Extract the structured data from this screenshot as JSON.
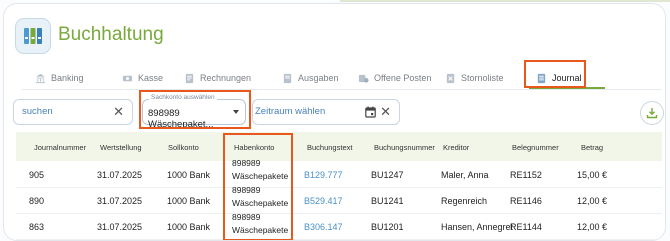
{
  "app": {
    "title": "Buchhaltung",
    "icon": "binders-icon"
  },
  "tabs": [
    {
      "label": "Banking",
      "icon": "bank-icon"
    },
    {
      "label": "Kasse",
      "icon": "cash-icon"
    },
    {
      "label": "Rechnungen",
      "icon": "invoice-icon"
    },
    {
      "label": "Ausgaben",
      "icon": "receipt-icon"
    },
    {
      "label": "Offene Posten",
      "icon": "open-items-icon"
    },
    {
      "label": "Stornoliste",
      "icon": "storno-icon"
    },
    {
      "label": "Journal",
      "icon": "journal-icon",
      "active": true
    }
  ],
  "filters": {
    "search_placeholder": "suchen",
    "account_label": "Sachkonto auswählen",
    "account_value": "898989 Wäschepaket...",
    "date_placeholder": "Zeitraum wählen"
  },
  "table": {
    "headers": [
      "Journalnummer",
      "Wertstellung",
      "Sollkonto",
      "Habenkonto",
      "Buchungstext",
      "Buchungsnummer",
      "Kreditor",
      "Belegnummer",
      "Betrag"
    ],
    "rows": [
      {
        "journalnummer": "905",
        "wertstellung": "31.07.2025",
        "sollkonto": "1000 Bank",
        "habenkonto_1": "898989",
        "habenkonto_2": "Wäschepakete",
        "buchungstext": "B129.777",
        "buchungsnummer": "BU1247",
        "kreditor": "Maler, Anna",
        "belegnummer": "RE1152",
        "betrag": "15,00 €"
      },
      {
        "journalnummer": "890",
        "wertstellung": "31.07.2025",
        "sollkonto": "1000 Bank",
        "habenkonto_1": "898989",
        "habenkonto_2": "Wäschepakete",
        "buchungstext": "B529.417",
        "buchungsnummer": "BU1241",
        "kreditor": "Regenreich",
        "belegnummer": "RE1146",
        "betrag": "12,00 €"
      },
      {
        "journalnummer": "863",
        "wertstellung": "31.07.2025",
        "sollkonto": "1000 Bank",
        "habenkonto_1": "898989",
        "habenkonto_2": "Wäschepakete",
        "buchungstext": "B306.147",
        "buchungsnummer": "BU1201",
        "kreditor": "Hansen, Annegret",
        "belegnummer": "RE1144",
        "betrag": "12,00 €"
      }
    ]
  },
  "colors": {
    "brand_green": "#79a93a",
    "highlight_orange": "#e8571c",
    "link_blue": "#4a90c8"
  }
}
